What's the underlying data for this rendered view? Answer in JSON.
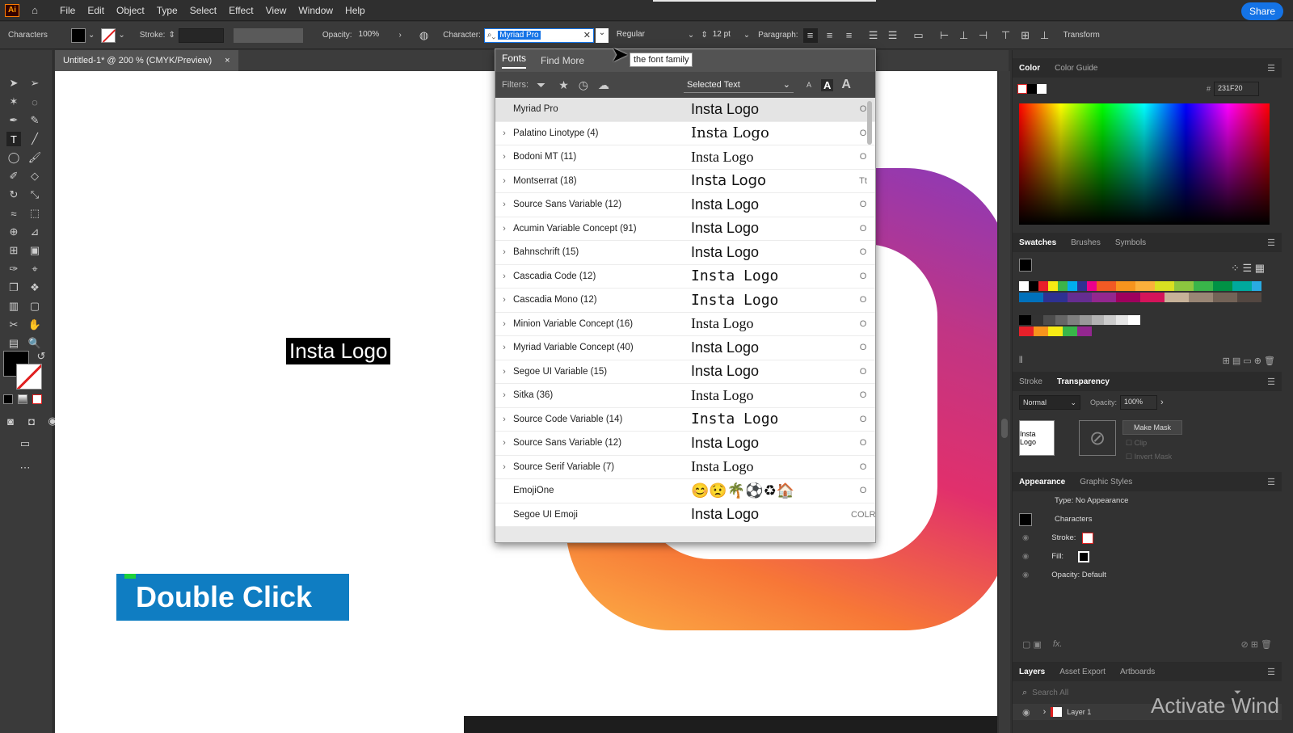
{
  "app": {
    "logo": "Ai",
    "share_label": "Share"
  },
  "menu": [
    "File",
    "Edit",
    "Object",
    "Type",
    "Select",
    "Effect",
    "View",
    "Window",
    "Help"
  ],
  "control_bar": {
    "context_label": "Characters",
    "stroke_label": "Stroke:",
    "opacity_label": "Opacity:",
    "opacity_value": "100%",
    "character_label": "Character:",
    "font_family_value": "Myriad Pro",
    "font_style_value": "Regular",
    "font_size_value": "12 pt",
    "paragraph_label": "Paragraph:",
    "transform_label": "Transform",
    "tooltip": "the font family"
  },
  "document_tab": {
    "title": "Untitled-1* @ 200 % (CMYK/Preview)",
    "close": "×"
  },
  "canvas": {
    "selected_text": "Insta Logo",
    "overlay_label": "Double Click",
    "watermark": "Activate Wind"
  },
  "font_menu": {
    "tabs": [
      "Fonts",
      "Find More"
    ],
    "filters_label": "Filters:",
    "preview_mode": "Selected Text",
    "fonts": [
      {
        "name": "Myriad Pro",
        "preview": "Insta Logo",
        "expand": false,
        "ptype": "O",
        "style": "serif-less"
      },
      {
        "name": "Palatino Linotype (4)",
        "preview": "Insta Logo",
        "expand": true,
        "ptype": "O",
        "style": "palatino"
      },
      {
        "name": "Bodoni MT (11)",
        "preview": "Insta Logo",
        "expand": true,
        "ptype": "O",
        "style": "bodoni"
      },
      {
        "name": "Montserrat (18)",
        "preview": "Insta Logo",
        "expand": true,
        "ptype": "Tt",
        "style": "wide"
      },
      {
        "name": "Source Sans Variable (12)",
        "preview": "Insta Logo",
        "expand": true,
        "ptype": "O",
        "style": "sans"
      },
      {
        "name": "Acumin Variable Concept (91)",
        "preview": "Insta Logo",
        "expand": true,
        "ptype": "O",
        "style": "sans"
      },
      {
        "name": "Bahnschrift (15)",
        "preview": "Insta Logo",
        "expand": true,
        "ptype": "O",
        "style": "sans"
      },
      {
        "name": "Cascadia Code (12)",
        "preview": "Insta Logo",
        "expand": true,
        "ptype": "O",
        "style": "mono"
      },
      {
        "name": "Cascadia Mono (12)",
        "preview": "Insta Logo",
        "expand": true,
        "ptype": "O",
        "style": "mono"
      },
      {
        "name": "Minion Variable Concept (16)",
        "preview": "Insta Logo",
        "expand": true,
        "ptype": "O",
        "style": "serif"
      },
      {
        "name": "Myriad Variable Concept (40)",
        "preview": "Insta Logo",
        "expand": true,
        "ptype": "O",
        "style": "sans"
      },
      {
        "name": "Segoe UI Variable (15)",
        "preview": "Insta Logo",
        "expand": true,
        "ptype": "O",
        "style": "sans"
      },
      {
        "name": "Sitka (36)",
        "preview": "Insta Logo",
        "expand": true,
        "ptype": "O",
        "style": "serif"
      },
      {
        "name": "Source Code Variable (14)",
        "preview": "Insta Logo",
        "expand": true,
        "ptype": "O",
        "style": "mono"
      },
      {
        "name": "Source Sans Variable (12)",
        "preview": "Insta Logo",
        "expand": true,
        "ptype": "O",
        "style": "sans"
      },
      {
        "name": "Source Serif Variable (7)",
        "preview": "Insta Logo",
        "expand": true,
        "ptype": "O",
        "style": "serif"
      },
      {
        "name": "EmojiOne",
        "preview": "😊😟🌴⚽♻🏠",
        "expand": false,
        "ptype": "O",
        "style": "sans"
      },
      {
        "name": "Segoe UI Emoji",
        "preview": "Insta Logo",
        "expand": false,
        "ptype": "COLR",
        "style": "sans"
      }
    ]
  },
  "panels": {
    "color": {
      "tabs": [
        "Color",
        "Color Guide"
      ],
      "hex_label": "#",
      "hex": "231F20"
    },
    "swatches": {
      "tabs": [
        "Swatches",
        "Brushes",
        "Symbols"
      ]
    },
    "transparency": {
      "tabs": [
        "Stroke",
        "Transparency"
      ],
      "blend": "Normal",
      "opacity_label": "Opacity:",
      "opacity": "100%",
      "thumb_text": "Insta Logo",
      "make_mask": "Make Mask",
      "clip": "Clip",
      "invert": "Invert Mask"
    },
    "appearance": {
      "tabs": [
        "Appearance",
        "Graphic Styles"
      ],
      "type_label": "Type: No Appearance",
      "characters": "Characters",
      "stroke": "Stroke:",
      "fill": "Fill:",
      "opacity": "Opacity: Default",
      "fx": "fx."
    },
    "layers": {
      "tabs": [
        "Layers",
        "Asset Export",
        "Artboards"
      ],
      "search_placeholder": "Search All",
      "layer_name": "Layer 1"
    }
  },
  "colors": {
    "accent": "#1473e6",
    "selection": "#0a5bbf",
    "ig_purple": "#8a3ab9",
    "ig_pink": "#e1306c",
    "ig_orange": "#f77737",
    "ig_yellow": "#fcaf45"
  }
}
